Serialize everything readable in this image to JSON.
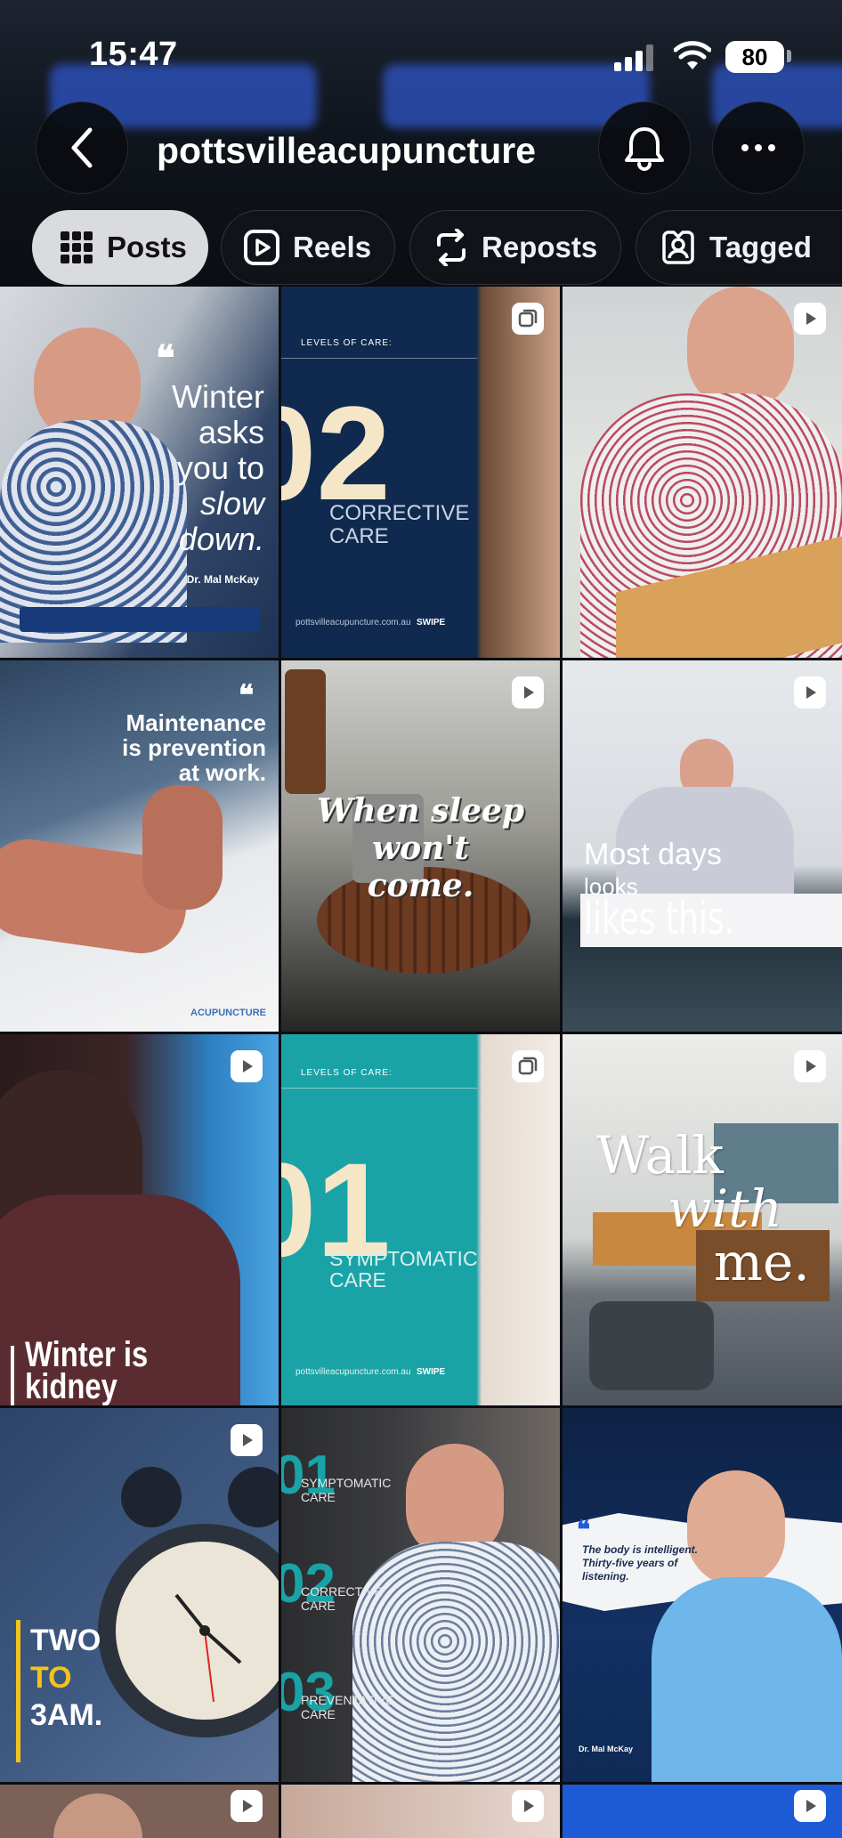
{
  "status_bar": {
    "time": "15:47",
    "battery": "80"
  },
  "header": {
    "username": "pottsvilleacupuncture"
  },
  "tabs": [
    {
      "label": "Posts",
      "icon": "grid-icon",
      "active": true
    },
    {
      "label": "Reels",
      "icon": "reels-icon",
      "active": false
    },
    {
      "label": "Reposts",
      "icon": "repost-icon",
      "active": false
    },
    {
      "label": "Tagged",
      "icon": "tagged-icon",
      "active": false
    }
  ],
  "posts": {
    "p1": {
      "quote_mark": "❝",
      "l1": "Winter",
      "l2": "asks",
      "l3": "you to",
      "l4": "slow",
      "l5": "down.",
      "author": "Dr. Mal McKay"
    },
    "p2": {
      "kicker": "LEVELS OF CARE:",
      "number": "02",
      "l1": "CORRECTIVE",
      "l2": "CARE",
      "site": "pottsvilleacupuncture.com.au",
      "swipe": "SWIPE"
    },
    "p4": {
      "quote_mark": "❝",
      "l1": "Maintenance",
      "l2": "is prevention",
      "l3": "at work.",
      "logo": "ACUPUNCTURE"
    },
    "p5": {
      "l1": "When sleep",
      "l2": "won't",
      "l3": "come."
    },
    "p6": {
      "l1": "Most days",
      "l2": "looks",
      "l3": "likes this."
    },
    "p7": {
      "l1": "Winter is",
      "l2": "kidney"
    },
    "p8": {
      "kicker": "LEVELS OF CARE:",
      "number": "01",
      "l1": "SYMPTOMATIC",
      "l2": "CARE",
      "site": "pottsvilleacupuncture.com.au",
      "swipe": "SWIPE"
    },
    "p9": {
      "l1": "Walk",
      "l2": "with",
      "l3": "me."
    },
    "p10": {
      "l1": "TWO",
      "l2": "TO",
      "l3": "3AM."
    },
    "p11": {
      "levels": [
        {
          "num": "01",
          "name": "SYMPTOMATIC",
          "care": "CARE"
        },
        {
          "num": "02",
          "name": "CORRECTIVE",
          "care": "CARE"
        },
        {
          "num": "03",
          "name": "PREVENTATIVE",
          "care": "CARE"
        }
      ]
    },
    "p12": {
      "quote_mark": "❝",
      "l1": "The body is intelligent.",
      "l2": "Thirty-five years of",
      "l3": "listening.",
      "author": "Dr. Mal McKay"
    }
  },
  "colors": {
    "accent_blue": "#1d5bd6",
    "teal": "#1aa3a6",
    "navy": "#0f2a4e",
    "yellow": "#f4c21c"
  }
}
